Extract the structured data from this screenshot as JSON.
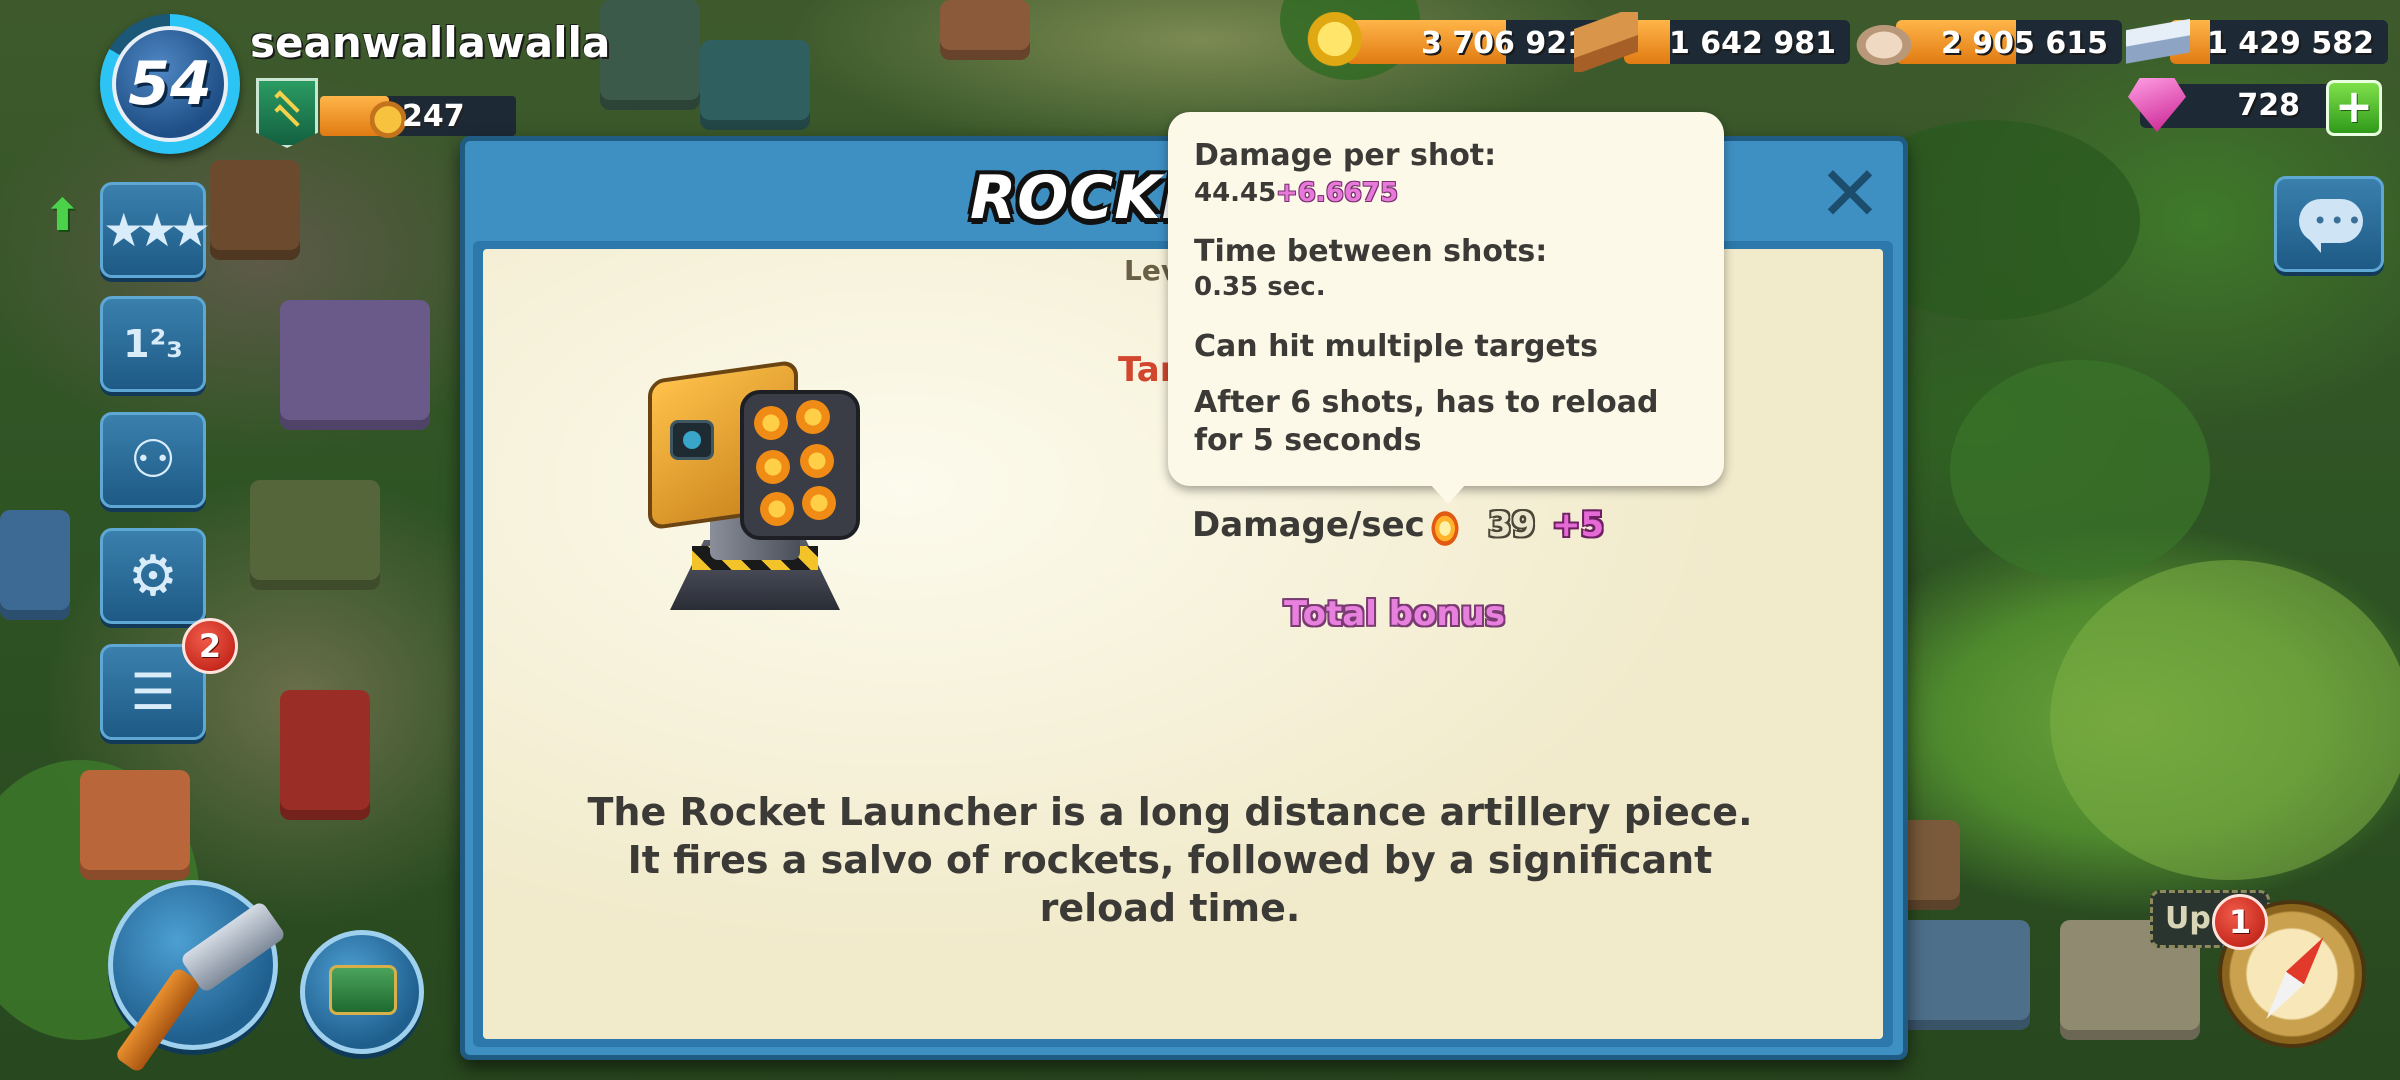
{
  "player": {
    "level": "54",
    "name": "seanwallawalla",
    "victory_points": "247",
    "victory_points_fill": 0.35
  },
  "resources": {
    "gold": "3 706 921",
    "wood": "1 642 981",
    "stone": "2 905 615",
    "iron": "1 429 582",
    "diamonds": "728"
  },
  "sidebar": {
    "reports_badge": "2"
  },
  "dialog": {
    "title": "ROCKET L",
    "level_partial": "Lev",
    "target_partial": "Tar",
    "damage_per_sec_label": "Damage/sec",
    "damage_per_sec_value": "39",
    "damage_per_sec_bonus": "+5",
    "total_bonus": "Total bonus",
    "description": "The Rocket Launcher is a long distance artillery piece. It fires a salvo of rockets, followed by a significant reload time."
  },
  "tooltip": {
    "damage_per_shot_label": "Damage per shot:",
    "damage_per_shot_value": "44.45",
    "damage_per_shot_bonus": "+6.6675",
    "time_between_shots_label": "Time between shots:",
    "time_between_shots_value": "0.35 sec.",
    "multi_target": "Can hit multiple targets",
    "reload_info": "After 6 shots, has to reload for 5 seconds"
  },
  "bottom_right": {
    "upgrade_label": "Up",
    "compass_badge": "1"
  },
  "colors": {
    "dialog_frame": "#3e8fc2",
    "paper": "#f1eacb",
    "bonus_pink": "#e77ad9",
    "resource_bar": "#ffb549"
  }
}
